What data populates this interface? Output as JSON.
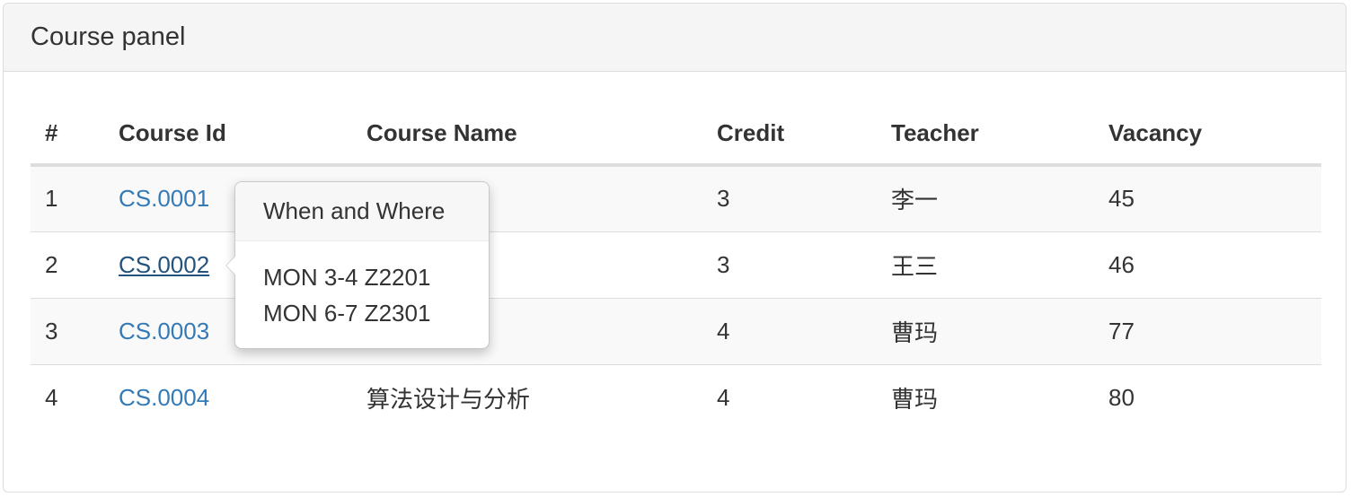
{
  "panel": {
    "title": "Course panel"
  },
  "table": {
    "headers": [
      "#",
      "Course Id",
      "Course Name",
      "Credit",
      "Teacher",
      "Vacancy"
    ],
    "rows": [
      {
        "num": "1",
        "course_id": "CS.0001",
        "course_name": "",
        "credit": "3",
        "teacher": "李一",
        "vacancy": "45"
      },
      {
        "num": "2",
        "course_id": "CS.0002",
        "course_name": "",
        "credit": "3",
        "teacher": "王三",
        "vacancy": "46"
      },
      {
        "num": "3",
        "course_id": "CS.0003",
        "course_name": "",
        "credit": "4",
        "teacher": "曹玛",
        "vacancy": "77"
      },
      {
        "num": "4",
        "course_id": "CS.0004",
        "course_name": "算法设计与分析",
        "credit": "4",
        "teacher": "曹玛",
        "vacancy": "80"
      }
    ]
  },
  "popover": {
    "title": "When and Where",
    "lines": [
      "MON 3-4 Z2201",
      "MON 6-7 Z2301"
    ]
  },
  "colors": {
    "link": "#337ab7",
    "link_active": "#23527c",
    "panel_heading_bg": "#f5f5f5",
    "stripe_bg": "#f9f9f9"
  }
}
